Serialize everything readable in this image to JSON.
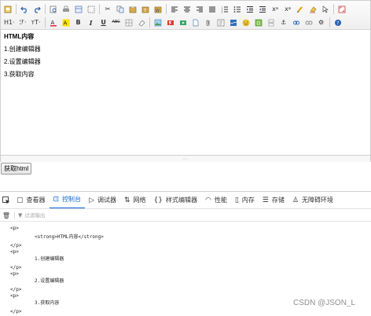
{
  "toolbar": {
    "row1": [
      "source-icon",
      "undo-icon",
      "redo-icon",
      "preview-icon",
      "print-icon",
      "template-icon",
      "select-all-icon",
      "cut-icon",
      "copy-icon",
      "paste-icon",
      "paste-text-icon",
      "paste-word-icon",
      "justify-left-icon",
      "justify-center-icon",
      "justify-right-icon",
      "justify-full-icon",
      "ordered-list-icon",
      "unordered-list-icon",
      "indent-icon",
      "outdent-icon",
      "subscript-icon",
      "superscript-icon",
      "format-painter-icon",
      "clear-format-icon",
      "cursor-icon",
      "fullscreen-icon"
    ],
    "heading_label": "H1·",
    "font_family_label": "ℱ·",
    "font_size_label": "ᴛT·",
    "row2_icons": [
      "text-color-icon",
      "highlight-icon",
      "bold-icon",
      "italic-icon",
      "underline-icon",
      "strikethrough-icon",
      "table-icon",
      "eraser-icon",
      "image-icon",
      "flash-icon",
      "media-icon",
      "file-icon",
      "attachment-icon",
      "code-icon",
      "map-icon",
      "emoji-icon",
      "special-char-icon",
      "page-break-icon",
      "anchor-icon",
      "link-icon",
      "unlink-icon",
      "settings-icon",
      "help-icon"
    ]
  },
  "editor": {
    "heading": "HTML内容",
    "items": [
      "1.创建编辑器",
      "2.设置编辑器",
      "3.获取内容"
    ]
  },
  "button": {
    "label": "获取html"
  },
  "devtools": {
    "tabs": [
      {
        "icon": "inspector-icon",
        "label": "查看器"
      },
      {
        "icon": "console-icon",
        "label": "控制台"
      },
      {
        "icon": "debugger-icon",
        "label": "调试器"
      },
      {
        "icon": "network-icon",
        "label": "网络"
      },
      {
        "icon": "style-editor-icon",
        "label": "样式编辑器"
      },
      {
        "icon": "performance-icon",
        "label": "性能"
      },
      {
        "icon": "memory-icon",
        "label": "内存"
      },
      {
        "icon": "storage-icon",
        "label": "存储"
      },
      {
        "icon": "accessibility-icon",
        "label": "无障碍环境"
      }
    ],
    "active_tab": "控制台",
    "filter_placeholder": "过滤输出",
    "console_lines": [
      "<p>",
      "<strong>HTML内容</strong>",
      "</p>",
      "<p>",
      "1.创建编辑器",
      "</p>",
      "<p>",
      "2.设置编辑器",
      "</p>",
      "<p>",
      "3.获取内容",
      "</p>"
    ]
  },
  "watermark": "CSDN @JSON_L"
}
